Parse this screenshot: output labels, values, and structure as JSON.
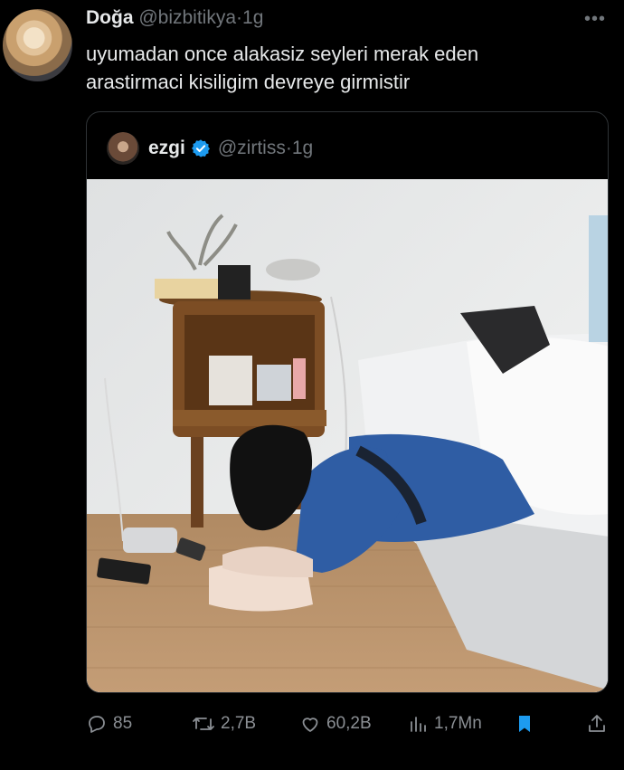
{
  "tweet": {
    "author_name": "Doğa",
    "author_handle": "@bizbitikya",
    "separator": "·",
    "time": "1g",
    "more_glyph": "•••",
    "text_line1": "uyumadan once alakasiz seyleri merak eden",
    "text_line2": "arastirmaci kisiligim devreye girmistir"
  },
  "quoted": {
    "author_name": "ezgi",
    "author_handle": "@zirtiss",
    "separator": "·",
    "time": "1g",
    "verified_color": "#1d9bf0"
  },
  "actions": {
    "replies": "85",
    "retweets": "2,7B",
    "likes": "60,2B",
    "views": "1,7Mn"
  },
  "colors": {
    "background": "#000000",
    "text": "#e7e9ea",
    "muted": "#71767b",
    "accent": "#1d9bf0"
  },
  "icons": [
    "more-icon",
    "verified-icon",
    "reply-icon",
    "retweet-icon",
    "like-icon",
    "views-icon",
    "bookmark-icon",
    "share-icon"
  ]
}
